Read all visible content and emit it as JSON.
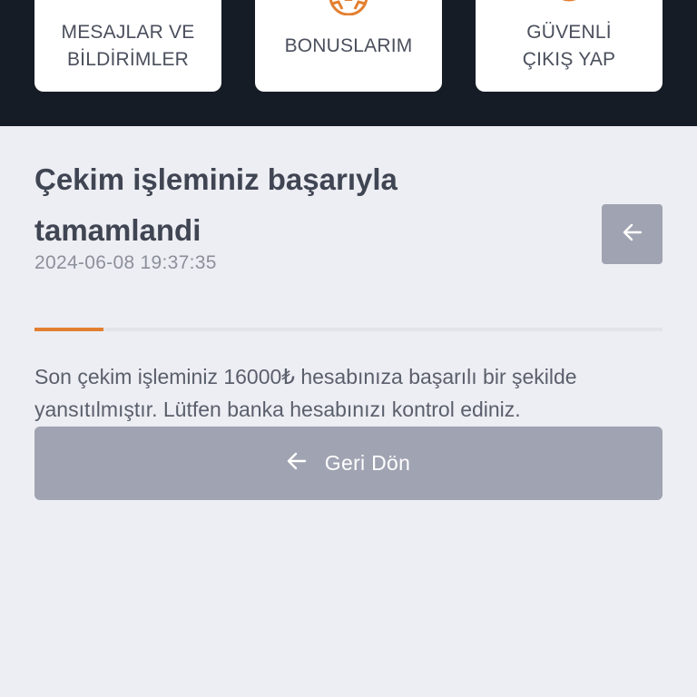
{
  "menu": {
    "items": [
      {
        "label": "MESAJLAR VE\nBİLDİRİMLER"
      },
      {
        "label": "BONUSLARIM"
      },
      {
        "label": "GÜVENLİ\nÇIKIŞ YAP"
      }
    ]
  },
  "status": {
    "title": "Çekim işleminiz başarıyla tamamlandi",
    "timestamp": "2024-06-08 19:37:35",
    "progress_percent": 11,
    "message": "Son çekim işleminiz 16000₺ hesabınıza başarılı bir şekilde yansıtılmıştır. Lütfen banka hesabınızı kontrol ediniz.",
    "back_button_label": "Geri Dön"
  },
  "icons": {
    "menu_icon": "soccer-ball-icon",
    "back_icon": "arrow-left-icon"
  },
  "colors": {
    "header_background": "#151c26",
    "page_background": "#edeef3",
    "accent": "#e37f30",
    "button_background": "#a0a3b1"
  }
}
